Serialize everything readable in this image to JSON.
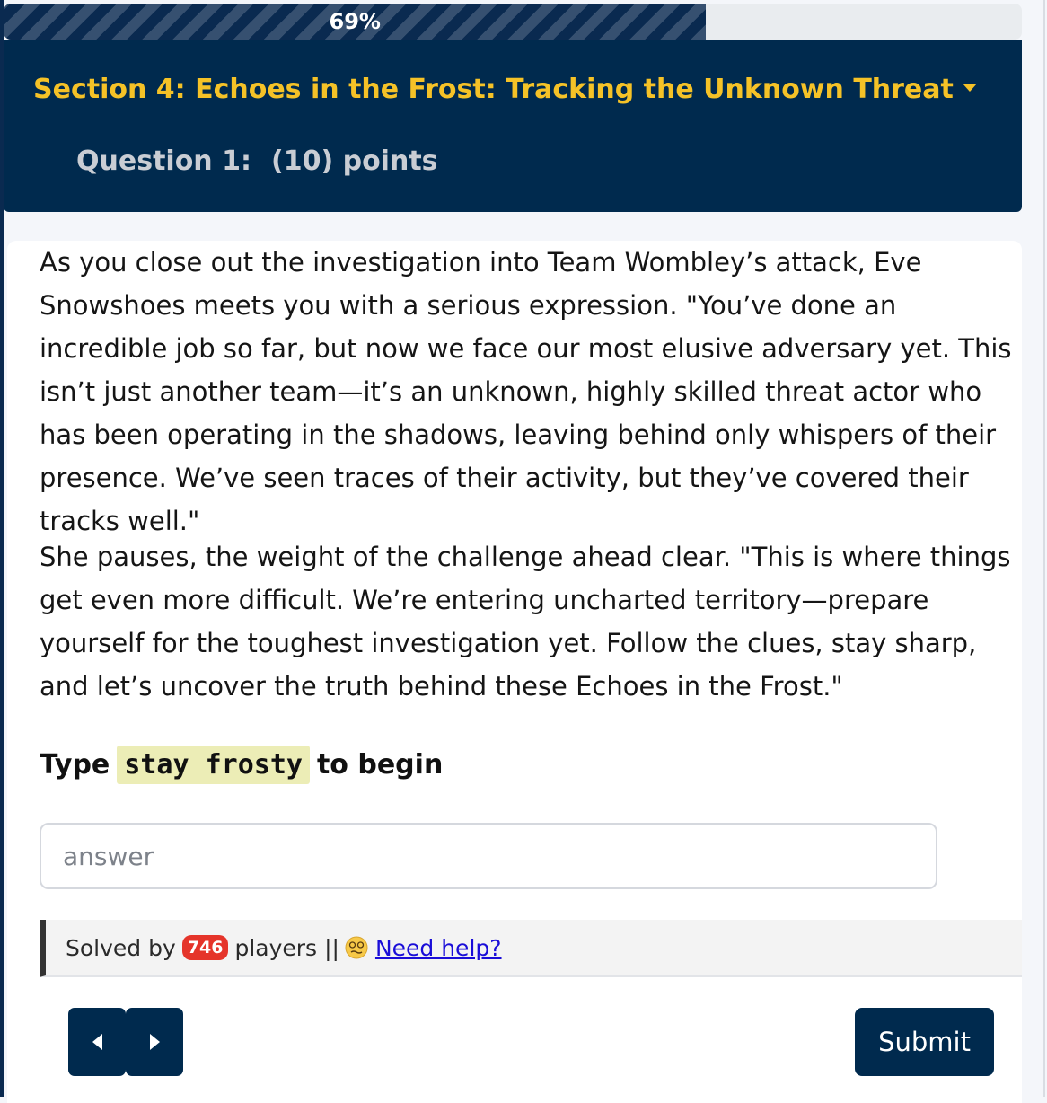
{
  "progress": {
    "percent": 69,
    "label": "69%"
  },
  "header": {
    "section_title": "Section 4: Echoes in the Frost: Tracking the Unknown Threat",
    "question_label": "Question 1:",
    "points_label": "(10) points"
  },
  "story": {
    "paragraph_1": "As you close out the investigation into Team Wombley’s attack, Eve Snowshoes meets you with a serious expression. \"You’ve done an incredible job so far, but now we face our most elusive adversary yet. This isn’t just another team—it’s an unknown, highly skilled threat actor who has been operating in the shadows, leaving behind only whispers of their presence. We’ve seen traces of their activity, but they’ve covered their tracks well.\"",
    "paragraph_2": "She pauses, the weight of the challenge ahead clear. \"This is where things get even more difficult. We’re entering uncharted territory—prepare yourself for the toughest investigation yet. Follow the clues, stay sharp, and let’s uncover the truth behind these Echoes in the Frost.\""
  },
  "prompt": {
    "prefix": "Type",
    "code": "stay frosty",
    "suffix": "to begin"
  },
  "answer": {
    "placeholder": "answer",
    "value": ""
  },
  "solved": {
    "prefix": "Solved by",
    "count": "746",
    "suffix": "players",
    "separator": "||",
    "help_label": "Need help?",
    "help_icon": "dizzy-face-emoji-icon"
  },
  "nav": {
    "prev_icon": "caret-left-icon",
    "next_icon": "caret-right-icon"
  },
  "submit_label": "Submit",
  "colors": {
    "navy": "#002a4e",
    "accent_gold": "#f5c227",
    "badge_red": "#e5342a",
    "link_blue": "#1a0dd8",
    "code_bg": "#ecedb6"
  }
}
